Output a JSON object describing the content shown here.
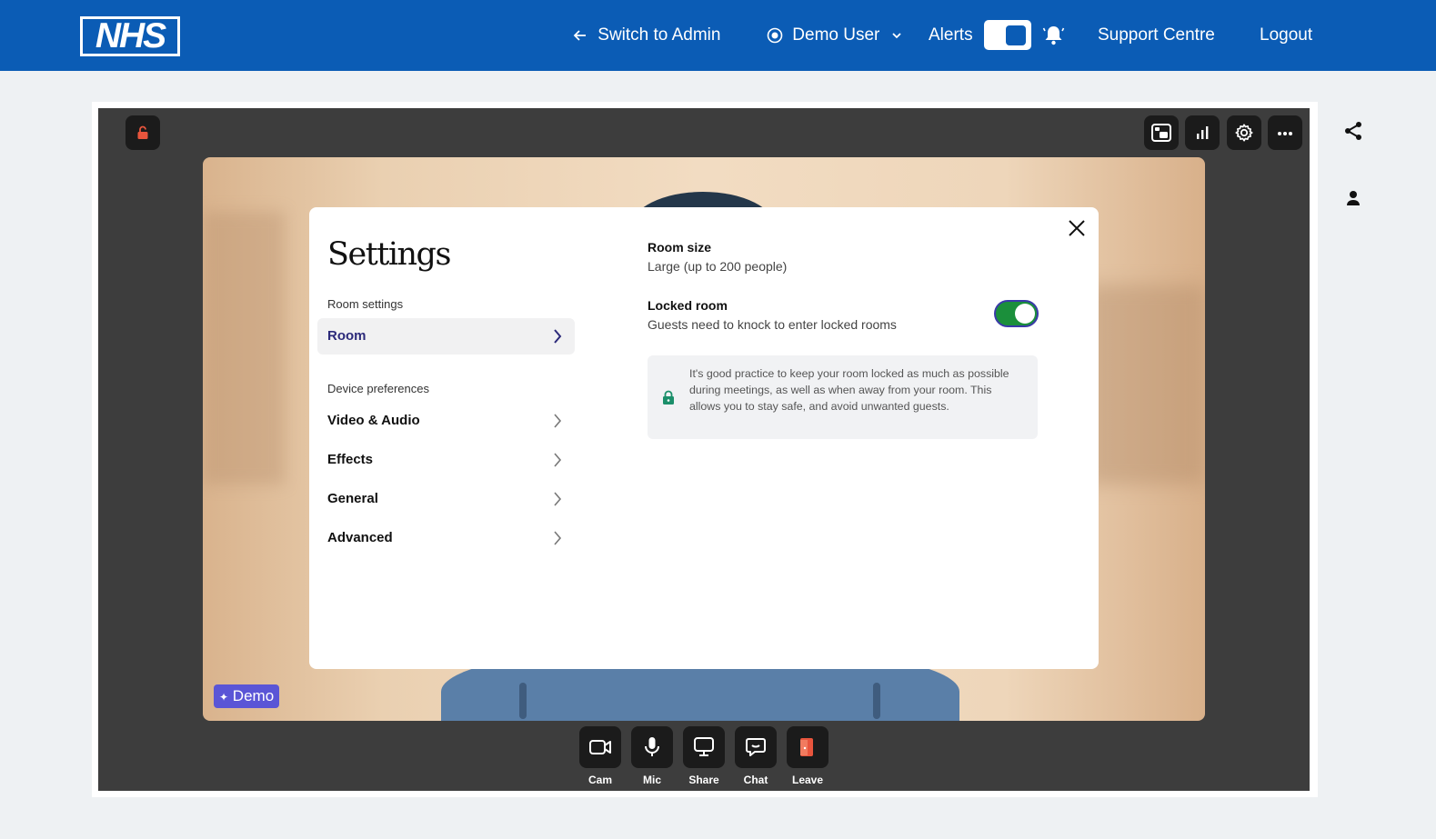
{
  "header": {
    "logo_text": "NHS",
    "switch_admin": "Switch to Admin",
    "user_name": "Demo User",
    "alerts_label": "Alerts",
    "support": "Support Centre",
    "logout": "Logout"
  },
  "video": {
    "badge": "Demo"
  },
  "controls": [
    {
      "label": "Cam"
    },
    {
      "label": "Mic"
    },
    {
      "label": "Share"
    },
    {
      "label": "Chat"
    },
    {
      "label": "Leave"
    }
  ],
  "settings": {
    "title": "Settings",
    "room_settings_label": "Room settings",
    "room_item": "Room",
    "device_preferences_label": "Device preferences",
    "items": [
      "Video & Audio",
      "Effects",
      "General",
      "Advanced"
    ],
    "room_size_title": "Room size",
    "room_size_value": "Large (up to 200 people)",
    "locked_title": "Locked room",
    "locked_desc": "Guests need to knock to enter locked rooms",
    "info_text": "It's good practice to keep your room locked as much as possible during meetings, as well as when away from your room. This allows you to stay safe, and avoid unwanted guests."
  },
  "colors": {
    "nhs_blue": "#0b5cb5",
    "toggle_on": "#1b8f3b",
    "badge": "#5a55d6",
    "leave": "#e8553d"
  }
}
